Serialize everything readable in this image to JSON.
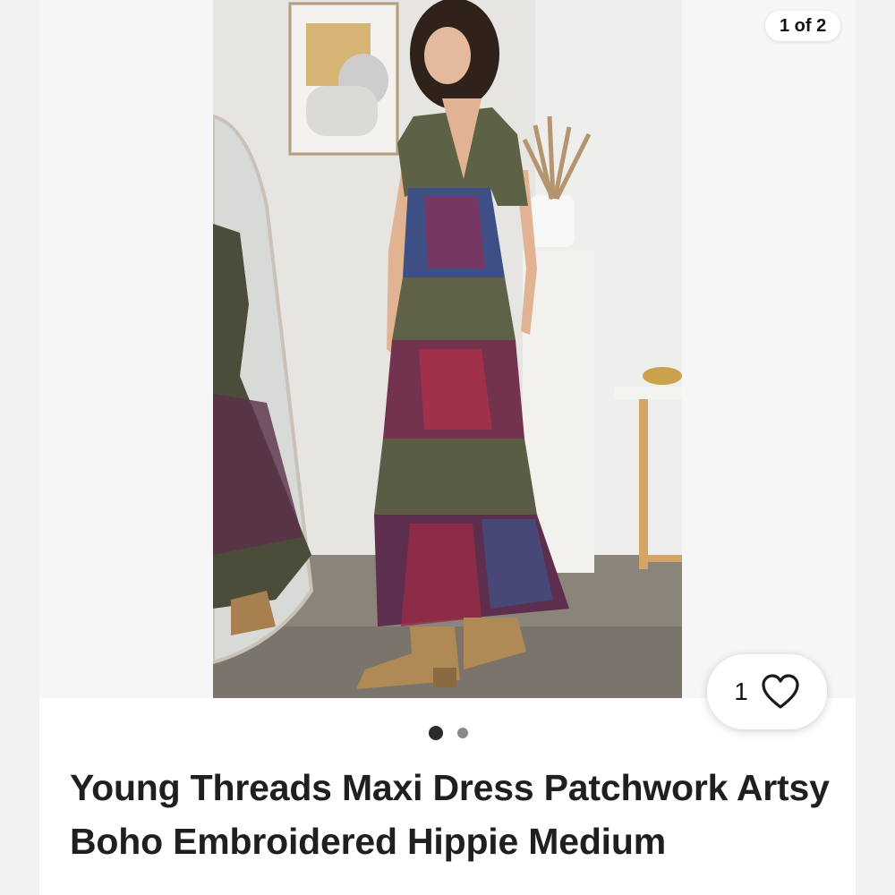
{
  "gallery": {
    "counter": "1 of 2",
    "current_page": 1,
    "total_pages": 2
  },
  "likes": {
    "count": "1"
  },
  "listing": {
    "title": "Young Threads Maxi Dress Patchwork Artsy Boho Embroidered Hippie Medium"
  },
  "icons": {
    "like": "heart-outline-icon"
  },
  "colors": {
    "active_dot": "#2b2b2b",
    "inactive_dot": "#8a8a8a"
  }
}
